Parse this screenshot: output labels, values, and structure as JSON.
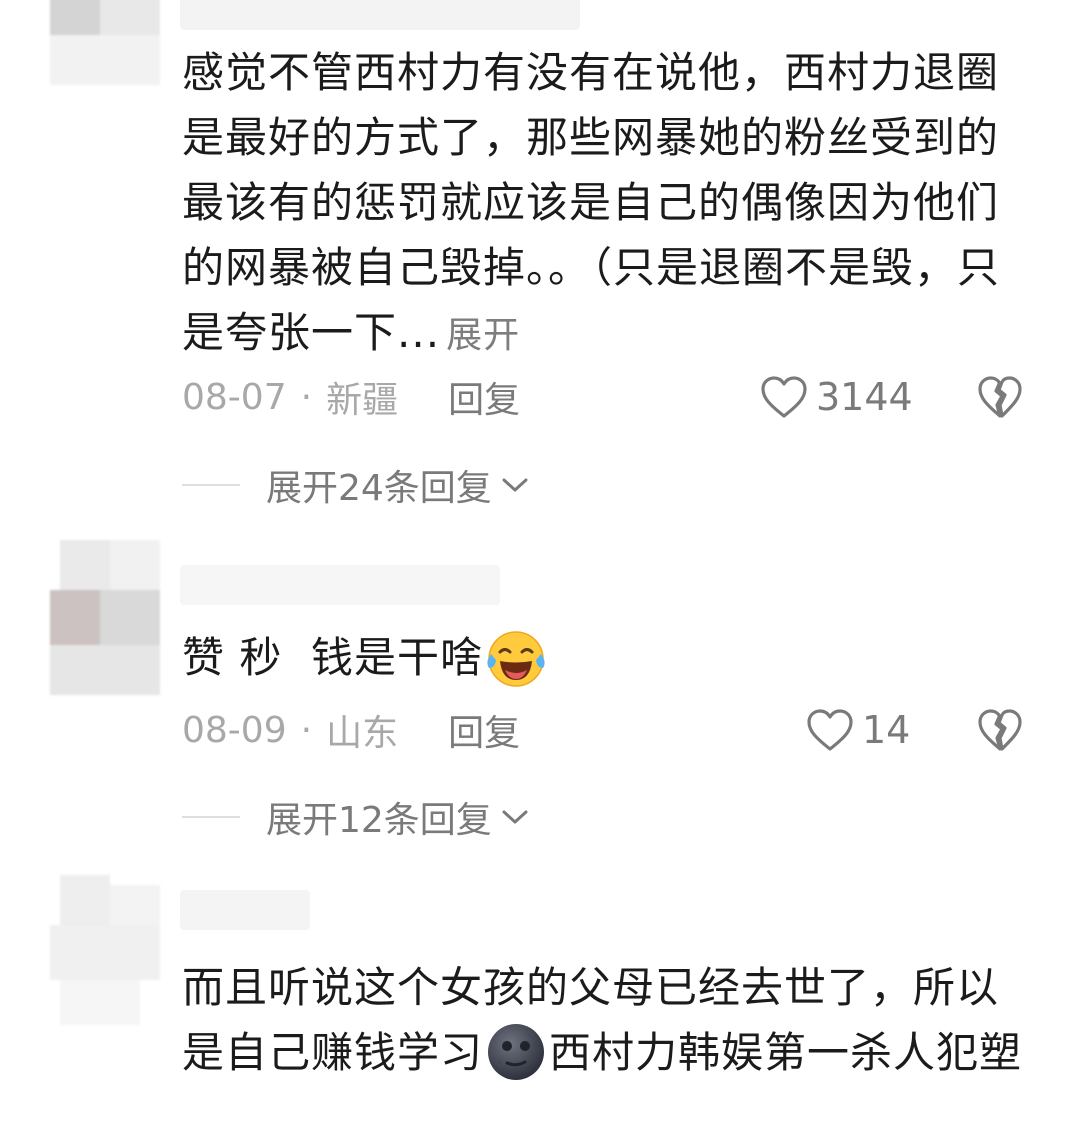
{
  "comments": [
    {
      "text": "感觉不管西村力有没有在说他，西村力退圈是最好的方式了，那些网暴她的粉丝受到的最该有的惩罚就应该是自己的偶像因为他们的网暴被自己毁掉。。（只是退圈不是毁，只是夸张一下...",
      "expand_label": "展开",
      "date": "08-07",
      "location": "新疆",
      "reply_label": "回复",
      "likes": "3144",
      "replies_label": "展开24条回复"
    },
    {
      "text": "赞 秒  钱是干啥",
      "emoji": "laughing-crying-face",
      "date": "08-09",
      "location": "山东",
      "reply_label": "回复",
      "likes": "14",
      "replies_label": "展开12条回复"
    },
    {
      "text_before": "而且听说这个女孩的父母已经去世了，所以是自己赚钱学习",
      "emoji": "new-moon-face",
      "text_after": "西村力韩娱第一杀人犯塑"
    }
  ],
  "separator": "·",
  "icons": {
    "like": "heart-outline-icon",
    "dislike": "broken-heart-icon",
    "chevron": "chevron-down-icon"
  },
  "colors": {
    "text": "#1b1b1b",
    "meta": "#a8a8a8",
    "secondary": "#7a7a7a"
  }
}
